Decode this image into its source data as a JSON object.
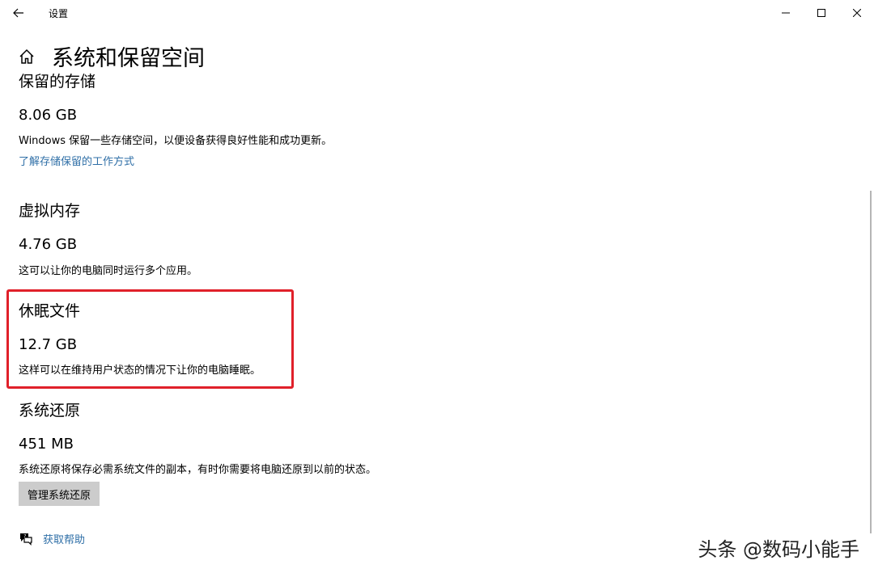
{
  "window": {
    "title": "设置"
  },
  "header": {
    "page_title": "系统和保留空间"
  },
  "sections": {
    "reserved": {
      "title": "保留的存储",
      "size": "8.06 GB",
      "description": "Windows 保留一些存储空间，以便设备获得良好性能和成功更新。",
      "link": "了解存储保留的工作方式"
    },
    "virtual_memory": {
      "title": "虚拟内存",
      "size": "4.76 GB",
      "description": "这可以让你的电脑同时运行多个应用。"
    },
    "hibernation": {
      "title": "休眠文件",
      "size": "12.7 GB",
      "description": "这样可以在维持用户状态的情况下让你的电脑睡眠。"
    },
    "system_restore": {
      "title": "系统还原",
      "size": "451 MB",
      "description": "系统还原将保存必需系统文件的副本，有时你需要将电脑还原到以前的状态。",
      "button": "管理系统还原"
    }
  },
  "help": {
    "label": "获取帮助"
  },
  "watermark": {
    "text": "头条 @数码小能手"
  },
  "colors": {
    "link": "#2f6fa7",
    "highlight": "#e0202a",
    "button_bg": "#cccccc"
  },
  "icons": {
    "back": "back-arrow-icon",
    "home": "home-icon",
    "minimize": "minimize-icon",
    "maximize": "maximize-icon",
    "close": "close-icon",
    "help": "help-chat-icon"
  }
}
